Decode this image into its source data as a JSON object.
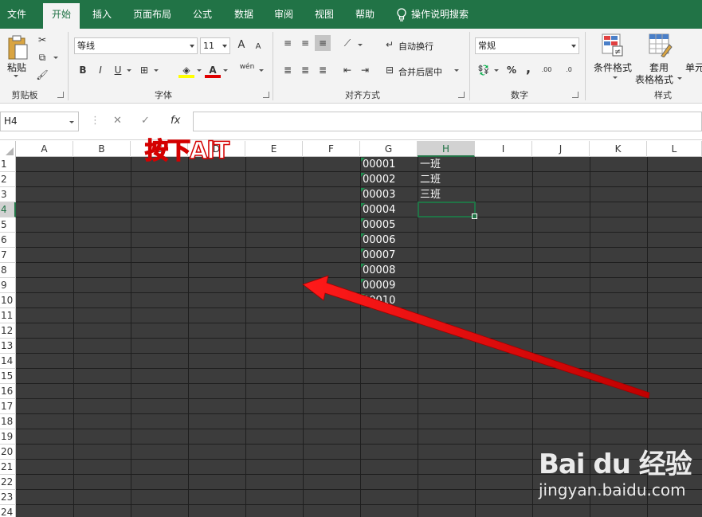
{
  "ribbon_tabs": [
    "文件",
    "开始",
    "插入",
    "页面布局",
    "公式",
    "数据",
    "审阅",
    "视图",
    "帮助"
  ],
  "tell_me": "操作说明搜索",
  "clipboard": {
    "paste": "粘贴",
    "label": "剪贴板"
  },
  "font": {
    "name": "等线",
    "size": "11",
    "label": "字体",
    "bold": "B",
    "italic": "I",
    "underline": "U",
    "grow": "A",
    "shrink": "A",
    "phonetic": "wén"
  },
  "alignment": {
    "wrap": "自动换行",
    "merge": "合并后居中",
    "label": "对齐方式"
  },
  "number": {
    "format": "常规",
    "percent": "%",
    "comma": ",",
    "label": "数字",
    "dec_inc": ".00",
    "dec_dec": ".0"
  },
  "styles": {
    "conditional": "条件格式",
    "table_format_1": "套用",
    "table_format_2": "表格格式",
    "cell_styles": "单元",
    "label": "样式"
  },
  "formula_bar": {
    "name_box": "H4",
    "fx": "fx",
    "cancel": "✕",
    "enter": "✓",
    "formula": ""
  },
  "columns": [
    "A",
    "B",
    "C",
    "D",
    "E",
    "F",
    "G",
    "H",
    "I",
    "J",
    "K",
    "L"
  ],
  "rows": [
    "1",
    "2",
    "3",
    "4",
    "5",
    "6",
    "7",
    "8",
    "9",
    "10",
    "11",
    "12",
    "13",
    "14",
    "15",
    "16",
    "17",
    "18",
    "19",
    "20",
    "21",
    "22",
    "23",
    "24"
  ],
  "col_g": [
    "00001",
    "00002",
    "00003",
    "00004",
    "00005",
    "00006",
    "00007",
    "00008",
    "00009",
    "00010"
  ],
  "col_h": [
    "一班",
    "二班",
    "三班"
  ],
  "annotation": "按下AlT",
  "watermark": {
    "brand": "Bai du 经验",
    "url": "jingyan.baidu.com"
  },
  "colors": {
    "ribbon_green": "#217346",
    "sheet_bg": "#3c3c3c",
    "arrow": "#e00000"
  }
}
